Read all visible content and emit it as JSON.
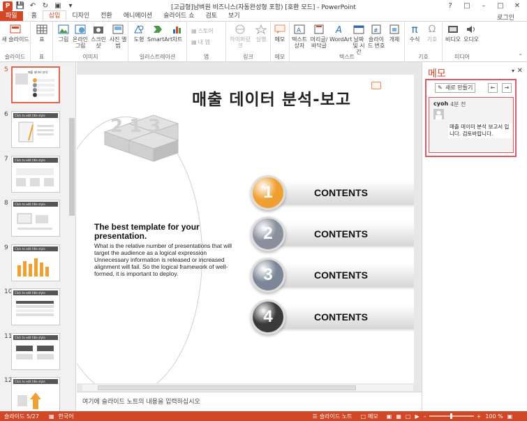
{
  "window": {
    "title": "[고급형]남벼원 비즈니스(자동완성형 포함) [호환 모드] - PowerPoint",
    "login_label": "로그인"
  },
  "tabs": [
    {
      "label": "파일"
    },
    {
      "label": "홈"
    },
    {
      "label": "삽입"
    },
    {
      "label": "디자인"
    },
    {
      "label": "전환"
    },
    {
      "label": "애니메이션"
    },
    {
      "label": "슬라이드 쇼"
    },
    {
      "label": "검토"
    },
    {
      "label": "보기"
    }
  ],
  "ribbon": {
    "groups": {
      "slides": "슬라이드",
      "table": "표",
      "images": "이미지",
      "illustrations": "일러스트레이션",
      "apps": "앱",
      "links": "링크",
      "comments": "메모",
      "text": "텍스트",
      "symbols": "기호",
      "media": "미디어"
    },
    "buttons": {
      "new_slide": "새 슬라이드",
      "table": "표",
      "pictures": "그림",
      "online_pictures": "온라인 그림",
      "screenshot": "스크린샷",
      "photo_album": "사진 앨범",
      "shapes": "도형",
      "smartart": "SmartArt",
      "chart": "차트",
      "store": "스토어",
      "my_apps": "내 앱",
      "hyperlink": "하이퍼링크",
      "action": "실행",
      "comment": "메모",
      "textbox": "텍스트 상자",
      "header_footer": "머리글/바닥글",
      "wordart": "WordArt",
      "date_time": "날짜 및 시간",
      "slide_number": "슬라이드 번호",
      "object": "개체",
      "equation": "수식",
      "symbol": "기호",
      "video": "비디오",
      "audio": "오디오"
    }
  },
  "thumbnails": [
    {
      "number": "5",
      "selected": true
    },
    {
      "number": "6"
    },
    {
      "number": "7"
    },
    {
      "number": "8"
    },
    {
      "number": "9"
    },
    {
      "number": "10"
    },
    {
      "number": "11"
    },
    {
      "number": "12"
    }
  ],
  "thumb_header_text": "Click to edit title style",
  "slide": {
    "title": "매출 데이터 분석-보고",
    "body_heading": "The best template for your presentation.",
    "body_text": "What is the relative number of presentations that will target the audience as a logical expression Unnecessary information is released or increased alignment will fail. So the logical framework of well-formed, it is important to deploy.",
    "contents": [
      {
        "num": "1",
        "label": "CONTENTS",
        "color": "#f0a030"
      },
      {
        "num": "2",
        "label": "CONTENTS",
        "color": "#8a8f9e"
      },
      {
        "num": "3",
        "label": "CONTENTS",
        "color": "#7b8796"
      },
      {
        "num": "4",
        "label": "CONTENTS",
        "color": "#3a3a3a"
      }
    ],
    "puzzle_numbers": "2 1 3"
  },
  "notes_placeholder": "여기에 슬라이드 노트의 내용을 입력하십시오",
  "memo_pane": {
    "title": "메모",
    "new_button": "새로 만들기",
    "comment": {
      "author": "cyoh",
      "time": "4분 전",
      "text": "매출 데이터 분석 보고서 입니다. 검토바랍니다."
    }
  },
  "status": {
    "slide_info": "슬라이드 5/27",
    "language": "한국어",
    "notes": "슬라이드 노트",
    "comments": "메모",
    "zoom": "100 %"
  },
  "colors": {
    "accent": "#d24726",
    "highlight": "#e05561"
  }
}
